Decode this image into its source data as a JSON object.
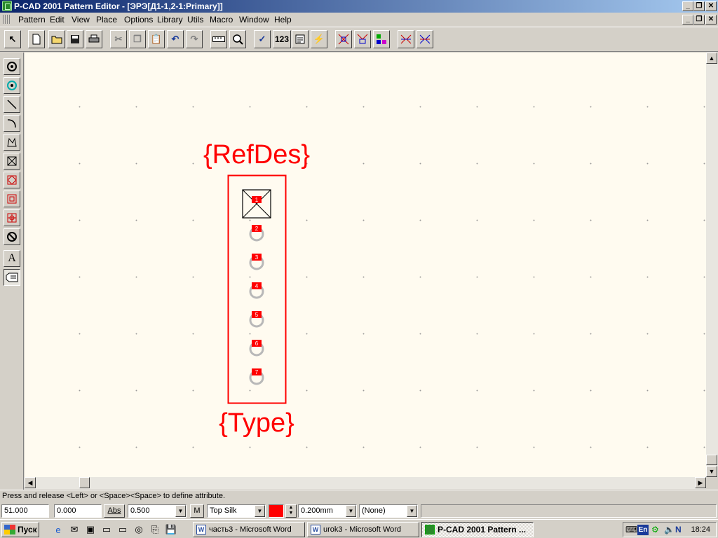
{
  "window": {
    "title": "P-CAD 2001 Pattern Editor - [ЭРЭ[Д1-1,2-1:Primary]]"
  },
  "menu": [
    "Pattern",
    "Edit",
    "View",
    "Place",
    "Options",
    "Library",
    "Utils",
    "Macro",
    "Window",
    "Help"
  ],
  "toolbar_icons": [
    "select-arrow-icon",
    "new-file-icon",
    "open-folder-icon",
    "save-icon",
    "print-icon",
    "cut-icon",
    "copy-icon",
    "paste-icon",
    "undo-icon",
    "redo-icon",
    "measure-icon",
    "zoom-icon",
    "check-icon",
    "renumber-icon",
    "pattern-wizard-icon",
    "drc-icon",
    "pin-icon",
    "pad-style-icon",
    "via-style-icon",
    "net-icon",
    "connect-icon"
  ],
  "toolbar_labels": {
    "check": "✓",
    "renumber": "123"
  },
  "left_tools": [
    "place-pad-icon",
    "place-via-icon",
    "place-line-icon",
    "place-arc-icon",
    "place-polygon-icon",
    "place-copper-pour-icon",
    "place-cutout-icon",
    "place-plane-icon",
    "place-keepout-icon",
    "place-forbidden-icon",
    "place-text-icon",
    "place-attribute-icon"
  ],
  "left_labels": {
    "text": "A"
  },
  "pattern": {
    "refdes_label": "{RefDes}",
    "type_label": "{Type}",
    "pins": [
      "1",
      "2",
      "3",
      "4",
      "5",
      "6",
      "7"
    ]
  },
  "colors": {
    "silk": "#ff0000",
    "canvas": "#fffbf0",
    "pad": "#b8b8b8"
  },
  "status": {
    "message": "Press and release <Left> or <Space><Space> to define attribute."
  },
  "fields": {
    "x": "51.000",
    "y": "0.000",
    "abs": "Abs",
    "grid": "0.500",
    "m": "M",
    "layer": "Top Silk",
    "width": "0.200mm",
    "net": "(None)"
  },
  "taskbar": {
    "start": "Пуск",
    "tasks": [
      "часть3 - Microsoft Word",
      "urok3 - Microsoft Word",
      "P-CAD 2001 Pattern ..."
    ],
    "lang": "En",
    "clock": "18:24"
  }
}
